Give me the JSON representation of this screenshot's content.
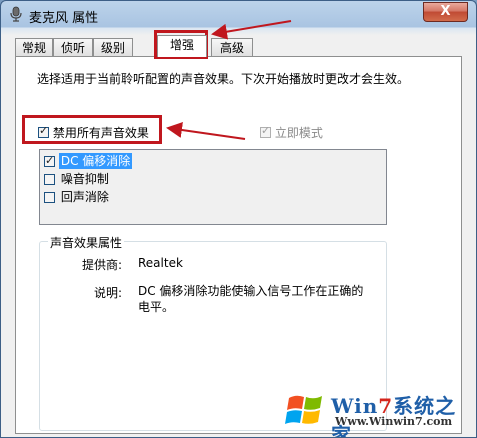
{
  "window": {
    "title": "麦克风 属性",
    "close_label": "X"
  },
  "tabs": [
    {
      "label": "常规"
    },
    {
      "label": "侦听"
    },
    {
      "label": "级别"
    },
    {
      "label": "增强"
    },
    {
      "label": "高级"
    }
  ],
  "active_tab": "增强",
  "description": "选择适用于当前聆听配置的声音效果。下次开始播放时更改才会生效。",
  "disable_all": {
    "label": "禁用所有声音效果",
    "checked": true
  },
  "immediate_mode": {
    "label": "立即模式",
    "checked": true,
    "enabled": false
  },
  "effects": [
    {
      "label": "DC 偏移消除",
      "checked": true,
      "selected": true
    },
    {
      "label": "噪音抑制",
      "checked": false,
      "selected": false
    },
    {
      "label": "回声消除",
      "checked": false,
      "selected": false
    }
  ],
  "properties": {
    "group_title": "声音效果属性",
    "provider_label": "提供商:",
    "provider_value": "Realtek",
    "description_label": "说明:",
    "description_value": "DC 偏移消除功能使输入信号工作在正确的电平。"
  },
  "colors": {
    "annotation": "#c0171e",
    "selection": "#3399ff"
  },
  "watermark": {
    "text_win": "Win",
    "text_7": "7",
    "text_rest": "系统之家",
    "url": "Www.Winwin7.com"
  }
}
